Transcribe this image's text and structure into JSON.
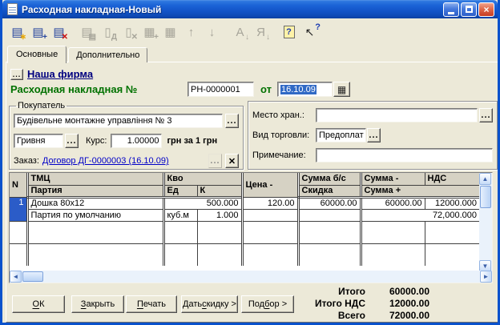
{
  "window": {
    "title": "Расходная накладная-Новый"
  },
  "toolbar": {
    "icons": [
      {
        "name": "new-row",
        "glyph": "▤",
        "overlay": "∗",
        "enabled": true
      },
      {
        "name": "add-row",
        "glyph": "▤",
        "overlay": "+",
        "enabled": true
      },
      {
        "name": "delete-row",
        "glyph": "▤",
        "overlay": "✕",
        "enabled": false
      },
      {
        "name": "copy-row",
        "glyph": "▤",
        "overlay": "▤",
        "enabled": false
      },
      {
        "name": "write-document",
        "glyph": "▯",
        "overlay": "Д",
        "enabled": false
      },
      {
        "name": "post-document",
        "glyph": "▯",
        "overlay": "✕",
        "enabled": false
      },
      {
        "name": "table-settings",
        "glyph": "▦",
        "overlay": "+",
        "enabled": false
      },
      {
        "name": "insert-column",
        "glyph": "▦",
        "overlay": "",
        "enabled": false
      },
      {
        "name": "move-up",
        "glyph": "↑",
        "overlay": "",
        "enabled": false
      },
      {
        "name": "move-down",
        "glyph": "↓",
        "overlay": "",
        "enabled": false
      },
      {
        "name": "sort-ascending",
        "glyph": "А",
        "overlay": "↓",
        "enabled": false
      },
      {
        "name": "sort-descending",
        "glyph": "Я",
        "overlay": "↓",
        "enabled": false
      },
      {
        "name": "help",
        "glyph": "?",
        "overlay": "",
        "enabled": true
      },
      {
        "name": "context-help",
        "glyph": "↖",
        "overlay": "?",
        "enabled": true
      }
    ]
  },
  "tabs": {
    "main": "Основные",
    "extra": "Дополнительно"
  },
  "ui": {
    "ellipsis": "...",
    "calendar_glyph": "▦",
    "clear_glyph": "✕"
  },
  "firm": {
    "link": "Наша фирма"
  },
  "doc": {
    "title": "Расходная накладная №",
    "number": "РН-0000001",
    "of": "от",
    "date": "16.10.09"
  },
  "buyer": {
    "legend": "Покупатель",
    "name": "Будівельне монтажне управління № 3",
    "currency": "Гривня",
    "rate_label": "Курс:",
    "rate": "1.00000",
    "rate_units": "грн за 1 грн",
    "order_label": "Заказ:",
    "order": "Договор ДГ-0000003 (16.10.09)"
  },
  "details": {
    "storage_label": "Место хран.:",
    "storage": "",
    "trade_label": "Вид торговли:",
    "trade": "Предоплат",
    "note_label": "Примечание:",
    "note": ""
  },
  "grid": {
    "headers": {
      "n": "N",
      "tmc": "ТМЦ",
      "party": "Партия",
      "qty": "Кво",
      "unit": "Ед",
      "k": "К",
      "price": "Цена -",
      "sum_base": "Сумма б/с",
      "discount": "Скидка",
      "sum_minus": "Сумма -",
      "sum_plus": "Сумма +",
      "vat": "НДС"
    },
    "row": {
      "num": "1",
      "tmc": "Дошка 80x12",
      "qty": "500.000",
      "price": "120.00",
      "sum_base": "60000.00",
      "sum_minus": "60000.00",
      "vat": "12000.000",
      "party": "Партия по умолчанию",
      "unit": "куб.м",
      "coef": "1.000",
      "sum_plus": "72,000.000"
    }
  },
  "footer": {
    "buttons": [
      {
        "text": "ОК",
        "accel": 0
      },
      {
        "text": "Закрыть",
        "accel": 0
      },
      {
        "text": "Печать",
        "accel": 0
      },
      {
        "text": "Дать скидку >",
        "accel": 5
      },
      {
        "text": "Подбор >",
        "accel": 3
      }
    ],
    "totals": [
      {
        "label": "Итого",
        "value": "60000.00"
      },
      {
        "label": "Итого НДС",
        "value": "12000.00"
      },
      {
        "label": "Всего",
        "value": "72000.00"
      }
    ]
  },
  "colors": {
    "heading_green": "#007100",
    "firm_link_navy": "#000080",
    "order_link_blue": "#0000C8",
    "selection_blue": "#316AC5",
    "row_select_blue": "#2B5CC8",
    "titlebar_blue": "#1254C8"
  }
}
